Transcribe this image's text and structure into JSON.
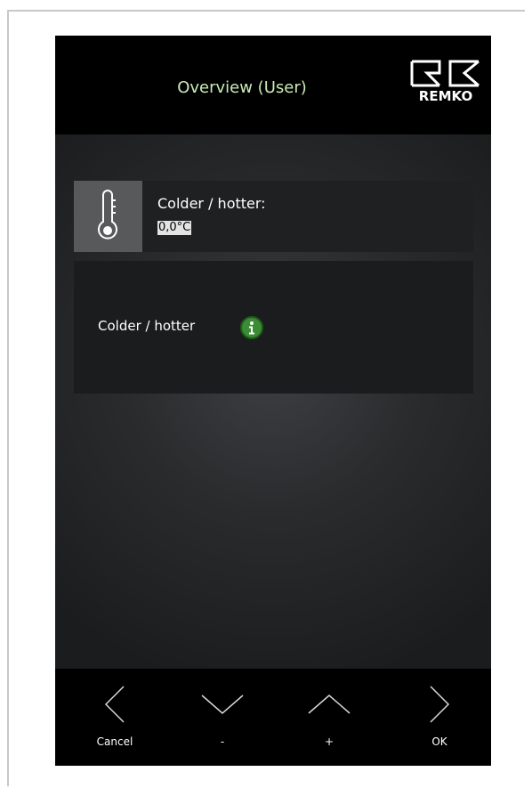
{
  "header": {
    "title": "Overview (User)",
    "logo_text": "REMKO"
  },
  "status_card": {
    "icon": "thermometer-icon",
    "label": "Colder / hotter:",
    "value": "0,0°C"
  },
  "detail_card": {
    "label": "Colder / hotter",
    "icon": "info-icon"
  },
  "footer": {
    "cancel_label": "Cancel",
    "minus_label": "-",
    "plus_label": "+",
    "ok_label": "OK"
  },
  "colors": {
    "title": "#c9ecb6",
    "accent_info": "#3b8c34",
    "thermo_bg": "#58595b"
  }
}
